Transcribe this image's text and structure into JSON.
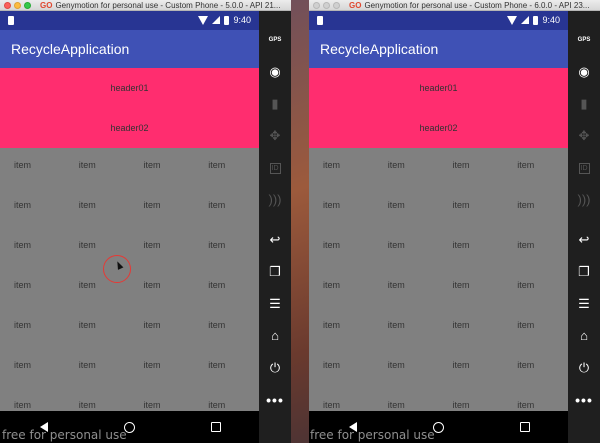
{
  "windows": [
    {
      "title": "Genymotion for personal use - Custom Phone - 5.0.0 - API 21...",
      "status_time": "9:40",
      "app_title": "RecycleApplication",
      "headers": [
        "header01",
        "header02"
      ],
      "grid_item_label": "item",
      "cursor_visible": true
    },
    {
      "title": "Genymotion for personal use - Custom Phone - 6.0.0 - API 23...",
      "status_time": "9:40",
      "app_title": "RecycleApplication",
      "headers": [
        "header01",
        "header02"
      ],
      "grid_item_label": "item",
      "cursor_visible": false
    }
  ],
  "grid": {
    "columns": 4,
    "rows": 7
  },
  "title_logo": "GO",
  "tools": [
    {
      "name": "gps-icon",
      "label": "GPS",
      "glyph": "",
      "dim": false
    },
    {
      "name": "webcam-icon",
      "label": "",
      "glyph": "◉",
      "dim": false
    },
    {
      "name": "battery-tool-icon",
      "label": "",
      "glyph": "▮",
      "dim": true
    },
    {
      "name": "dpad-icon",
      "label": "",
      "glyph": "✥",
      "dim": true
    },
    {
      "name": "device-id-icon",
      "label": "ID",
      "glyph": "",
      "dim": true
    },
    {
      "name": "network-icon",
      "label": "",
      "glyph": ")))",
      "dim": true
    },
    {
      "name": "back-icon",
      "label": "",
      "glyph": "↩",
      "dim": false
    },
    {
      "name": "recent-apps-icon",
      "label": "",
      "glyph": "❐",
      "dim": false
    },
    {
      "name": "menu-icon",
      "label": "",
      "glyph": "☰",
      "dim": false
    },
    {
      "name": "home-icon",
      "label": "",
      "glyph": "⌂",
      "dim": false
    },
    {
      "name": "power-icon",
      "label": "",
      "glyph": "⏻",
      "dim": false
    },
    {
      "name": "more-icon",
      "label": "",
      "glyph": "•••",
      "dim": false
    }
  ],
  "watermark": "free for personal use",
  "colors": {
    "status_bar": "#283593",
    "app_bar": "#3f51b5",
    "header_bg": "#ff2d6f",
    "grid_bg": "#808080"
  }
}
